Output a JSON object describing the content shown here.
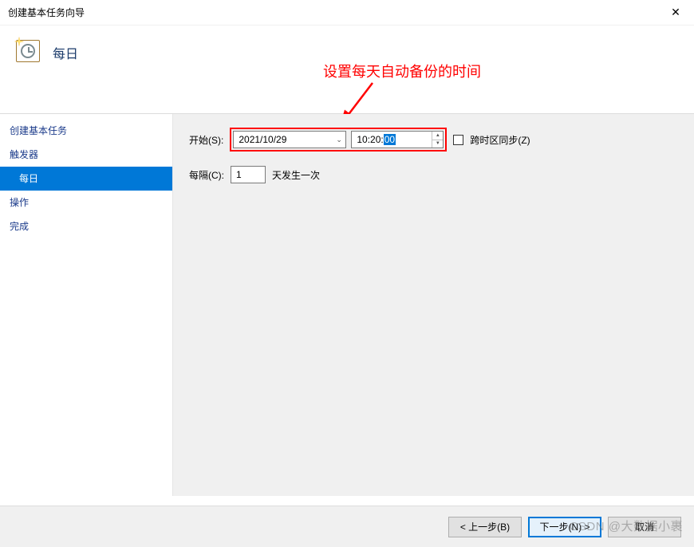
{
  "window": {
    "title": "创建基本任务向导",
    "close_glyph": "✕"
  },
  "header": {
    "page_title": "每日"
  },
  "annotation": {
    "text": "设置每天自动备份的时间"
  },
  "sidebar": {
    "items": [
      {
        "label": "创建基本任务",
        "selected": false,
        "sub": false
      },
      {
        "label": "触发器",
        "selected": false,
        "sub": false
      },
      {
        "label": "每日",
        "selected": true,
        "sub": true
      },
      {
        "label": "操作",
        "selected": false,
        "sub": false
      },
      {
        "label": "完成",
        "selected": false,
        "sub": false
      }
    ]
  },
  "form": {
    "start_label": "开始(S):",
    "date_value": "2021/10/29",
    "time_hh": "10",
    "time_mm": "20",
    "time_ss": "00",
    "tz_sync_label": "跨时区同步(Z)",
    "interval_label": "每隔(C):",
    "interval_value": "1",
    "interval_suffix": "天发生一次"
  },
  "buttons": {
    "back": "< 上一步(B)",
    "next": "下一步(N) >",
    "cancel": "取消"
  },
  "watermark": "CSDN @大数据小裹"
}
